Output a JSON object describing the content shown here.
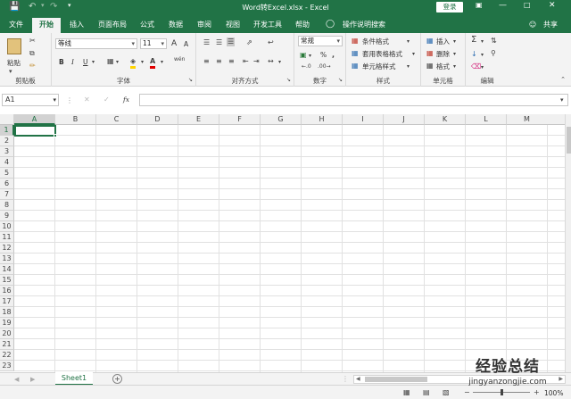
{
  "window": {
    "title": "Word转Excel.xlsx  -  Excel",
    "login": "登录"
  },
  "tabs": [
    "文件",
    "开始",
    "插入",
    "页面布局",
    "公式",
    "数据",
    "审阅",
    "视图",
    "开发工具",
    "帮助",
    "操作说明搜索"
  ],
  "share": "共享",
  "ribbon": {
    "clipboard": {
      "paste": "粘贴",
      "group": "剪贴板"
    },
    "font": {
      "name": "等线",
      "size": "11",
      "grow": "A",
      "shrink": "A",
      "bold": "B",
      "italic": "I",
      "underline": "U",
      "group": "字体"
    },
    "align": {
      "group": "对齐方式"
    },
    "number": {
      "format": "常规",
      "percent": "%",
      "group": "数字"
    },
    "styles": {
      "conditional": "条件格式",
      "table": "套用表格格式",
      "cell": "单元格样式",
      "group": "样式"
    },
    "cells": {
      "insert": "插入",
      "delete": "删除",
      "format": "格式",
      "group": "单元格"
    },
    "editing": {
      "group": "编辑"
    }
  },
  "formula": {
    "namebox": "A1",
    "fx": "fx"
  },
  "columns": [
    "A",
    "B",
    "C",
    "D",
    "E",
    "F",
    "G",
    "H",
    "I",
    "J",
    "K",
    "L",
    "M"
  ],
  "rows": [
    "1",
    "2",
    "3",
    "4",
    "5",
    "6",
    "7",
    "8",
    "9",
    "10",
    "11",
    "12",
    "13",
    "14",
    "15",
    "16",
    "17",
    "18",
    "19",
    "20",
    "21",
    "22",
    "23"
  ],
  "sheets": [
    "Sheet1"
  ],
  "status": {
    "zoom": "100%"
  },
  "watermark": {
    "text": "经验总结",
    "url": "jingyanzongjie.com"
  },
  "colors": {
    "accent": "#217346",
    "ribbon": "#f3f3f3",
    "gridline": "#e1e1e1"
  }
}
